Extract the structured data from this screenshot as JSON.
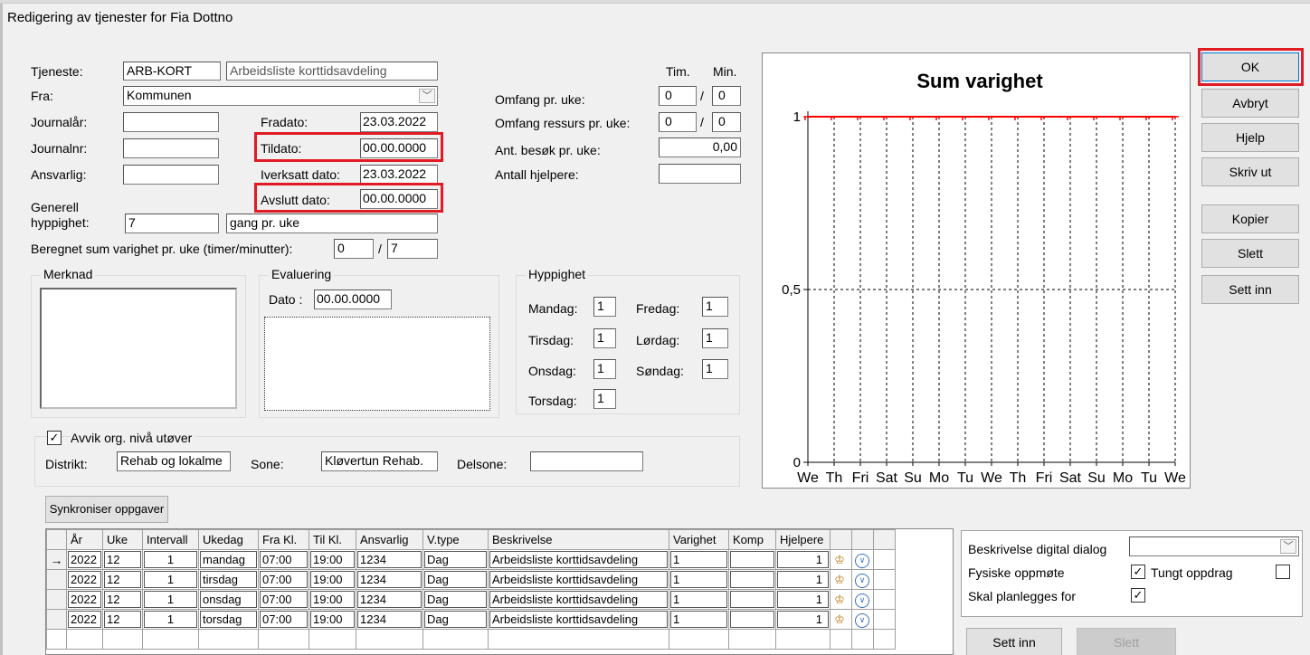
{
  "window": {
    "title": "Redigering av tjenester for Fia Dottno"
  },
  "form": {
    "tjeneste_label": "Tjeneste:",
    "tjeneste_code": "ARB-KORT",
    "tjeneste_name": "Arbeidsliste korttidsavdeling",
    "fra_label": "Fra:",
    "fra_value": "Kommunen",
    "journalar_label": "Journalår:",
    "journalar_value": "",
    "journalnr_label": "Journalnr:",
    "journalnr_value": "",
    "ansvarlig_label": "Ansvarlig:",
    "ansvarlig_value": "",
    "fradato_label": "Fradato:",
    "fradato_value": "23.03.2022",
    "tildato_label": "Tildato:",
    "tildato_value": "00.00.0000",
    "iverksatt_label": "Iverksatt dato:",
    "iverksatt_value": "23.03.2022",
    "avslutt_label": "Avslutt dato:",
    "avslutt_value": "00.00.0000",
    "generell_label_1": "Generell",
    "generell_label_2": "hyppighet:",
    "generell_value": "7",
    "generell_unit": "gang pr. uke",
    "beregnet_label": "Beregnet sum varighet pr. uke (timer/minutter):",
    "beregnet_timer": "0",
    "beregnet_min": "7",
    "tim_label": "Tim.",
    "min_label": "Min.",
    "omfang_label": "Omfang pr. uke:",
    "omfang_tim": "0",
    "omfang_min": "0",
    "omfang_ressurs_label": "Omfang ressurs pr. uke:",
    "omfang_ressurs_tim": "0",
    "omfang_ressurs_min": "0",
    "ant_besok_label": "Ant. besøk pr. uke:",
    "ant_besok_value": "0,00",
    "antall_hjelpere_label": "Antall hjelpere:",
    "antall_hjelpere_value": "",
    "slash": "/"
  },
  "merknad": {
    "caption": "Merknad",
    "value": ""
  },
  "evaluering": {
    "caption": "Evaluering",
    "dato_label": "Dato :",
    "dato_value": "00.00.0000",
    "text": ""
  },
  "hyppighet": {
    "caption": "Hyppighet",
    "days": [
      {
        "label": "Mandag:",
        "value": "1"
      },
      {
        "label": "Tirsdag:",
        "value": "1"
      },
      {
        "label": "Onsdag:",
        "value": "1"
      },
      {
        "label": "Torsdag:",
        "value": "1"
      },
      {
        "label": "Fredag:",
        "value": "1"
      },
      {
        "label": "Lørdag:",
        "value": "1"
      },
      {
        "label": "Søndag:",
        "value": "1"
      }
    ]
  },
  "avvik": {
    "checkbox_label": "Avvik org. nivå utøver",
    "checked": true,
    "distrikt_label": "Distrikt:",
    "distrikt_value": "Rehab og lokalme",
    "sone_label": "Sone:",
    "sone_value": "Kløvertun Rehab.",
    "delsone_label": "Delsone:",
    "delsone_value": ""
  },
  "buttons": {
    "ok": "OK",
    "avbryt": "Avbryt",
    "hjelp": "Hjelp",
    "skriv_ut": "Skriv ut",
    "kopier": "Kopier",
    "slett": "Slett",
    "sett_inn": "Sett inn",
    "synkroniser": "Synkroniser oppgaver",
    "bottom_sett_inn": "Sett inn",
    "bottom_slett": "Slett"
  },
  "chart_data": {
    "type": "line",
    "title": "Sum varighet",
    "categories": [
      "We",
      "Th",
      "Fri",
      "Sat",
      "Su",
      "Mo",
      "Tu",
      "We",
      "Th",
      "Fri",
      "Sat",
      "Su",
      "Mo",
      "Tu",
      "We"
    ],
    "series": [
      {
        "values": [
          1,
          1,
          1,
          1,
          1,
          1,
          1,
          1,
          1,
          1,
          1,
          1,
          1,
          1,
          1
        ],
        "color": "#ff0000"
      }
    ],
    "yticks": [
      "0",
      "0,5",
      "1"
    ],
    "ylim": [
      0,
      1
    ],
    "grid": true,
    "xlabel": "",
    "ylabel": ""
  },
  "table": {
    "columns": [
      "År",
      "Uke",
      "Intervall",
      "Ukedag",
      "Fra Kl.",
      "Til Kl.",
      "Ansvarlig",
      "V.type",
      "Beskrivelse",
      "Varighet",
      "Komp",
      "Hjelpere",
      "",
      "",
      ""
    ],
    "rows": [
      [
        "2022",
        "12",
        "1",
        "mandag",
        "07:00",
        "19:00",
        "1234",
        "Dag",
        "Arbeidsliste korttidsavdeling",
        "1",
        "",
        "1"
      ],
      [
        "2022",
        "12",
        "1",
        "tirsdag",
        "07:00",
        "19:00",
        "1234",
        "Dag",
        "Arbeidsliste korttidsavdeling",
        "1",
        "",
        "1"
      ],
      [
        "2022",
        "12",
        "1",
        "onsdag",
        "07:00",
        "19:00",
        "1234",
        "Dag",
        "Arbeidsliste korttidsavdeling",
        "1",
        "",
        "1"
      ],
      [
        "2022",
        "12",
        "1",
        "torsdag",
        "07:00",
        "19:00",
        "1234",
        "Dag",
        "Arbeidsliste korttidsavdeling",
        "1",
        "",
        "1"
      ]
    ],
    "current_row_marker": "→"
  },
  "side_panel": {
    "beskrivelse_label": "Beskrivelse digital dialog",
    "beskrivelse_value": "",
    "fysiske_label": "Fysiske oppmøte",
    "fysiske_checked": true,
    "tungt_label": "Tungt oppdrag",
    "tungt_checked": false,
    "planlegges_label": "Skal planlegges for",
    "planlegges_checked": true
  },
  "colors": {
    "highlight": "#e01b24",
    "chart_line": "#ff0000"
  }
}
